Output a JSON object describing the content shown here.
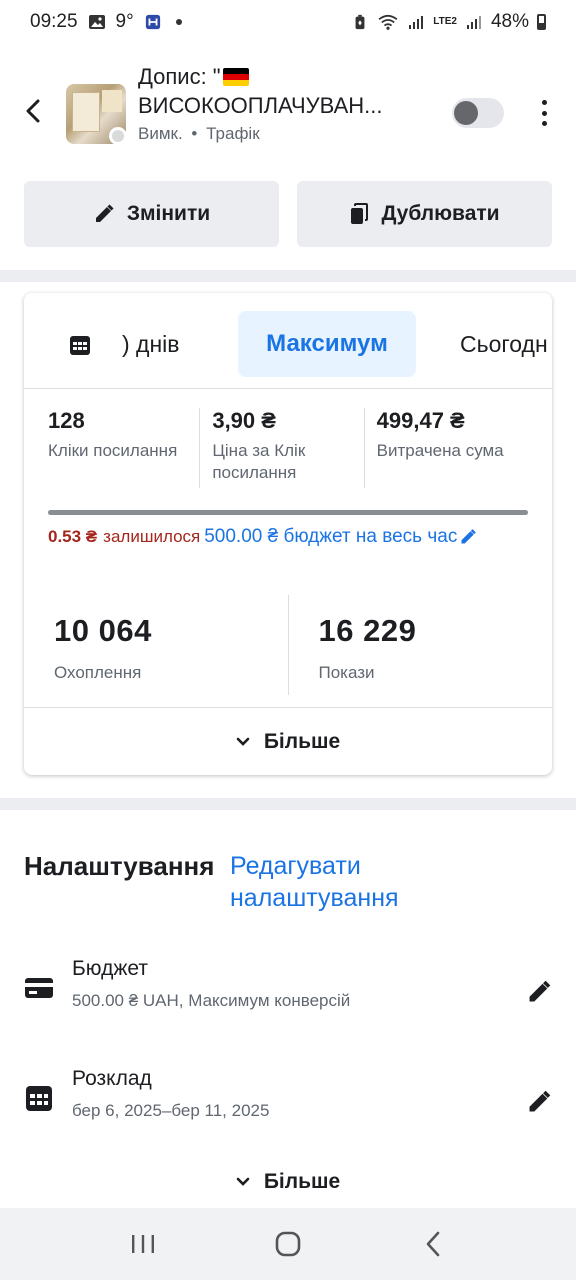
{
  "status_bar": {
    "time": "09:25",
    "temperature": "9°",
    "battery": "48%",
    "network_label": "LTE2"
  },
  "header": {
    "title_line1": "Допис: \"",
    "title_line2": "ВИСОКООПЛАЧУВАН...",
    "status": "Вимк.",
    "separator": "•",
    "objective": "Трафік",
    "toggle_on": false
  },
  "actions": {
    "edit_label": "Змінити",
    "duplicate_label": "Дублювати"
  },
  "stats": {
    "tabs": {
      "days_label": ") днів",
      "max_label": "Максимум",
      "today_label": "Сьогодн"
    },
    "metrics": [
      {
        "value": "128",
        "label": "Кліки посилання"
      },
      {
        "value": "3,90 ₴",
        "label": "Ціна за Клік посилання"
      },
      {
        "value": "499,47 ₴",
        "label": "Витрачена сума"
      }
    ],
    "budget_spent_fraction": 0.999,
    "remaining_amount": "0.53 ₴",
    "remaining_label": "залишилося",
    "budget_total": "500.00 ₴ бюджет на весь час",
    "reach_value": "10 064",
    "reach_label": "Охоплення",
    "impressions_value": "16 229",
    "impressions_label": "Покази",
    "more_label": "Більше"
  },
  "settings": {
    "title": "Налаштування",
    "edit_link": "Редагувати налаштування",
    "budget": {
      "title": "Бюджет",
      "subtitle": "500.00 ₴ UAH, Максимум конверсій"
    },
    "schedule": {
      "title": "Розклад",
      "subtitle": "бер 6, 2025–бер 11, 2025"
    },
    "more_label": "Більше"
  },
  "colors": {
    "accent": "#1b74e4",
    "warning": "#a4261c"
  }
}
